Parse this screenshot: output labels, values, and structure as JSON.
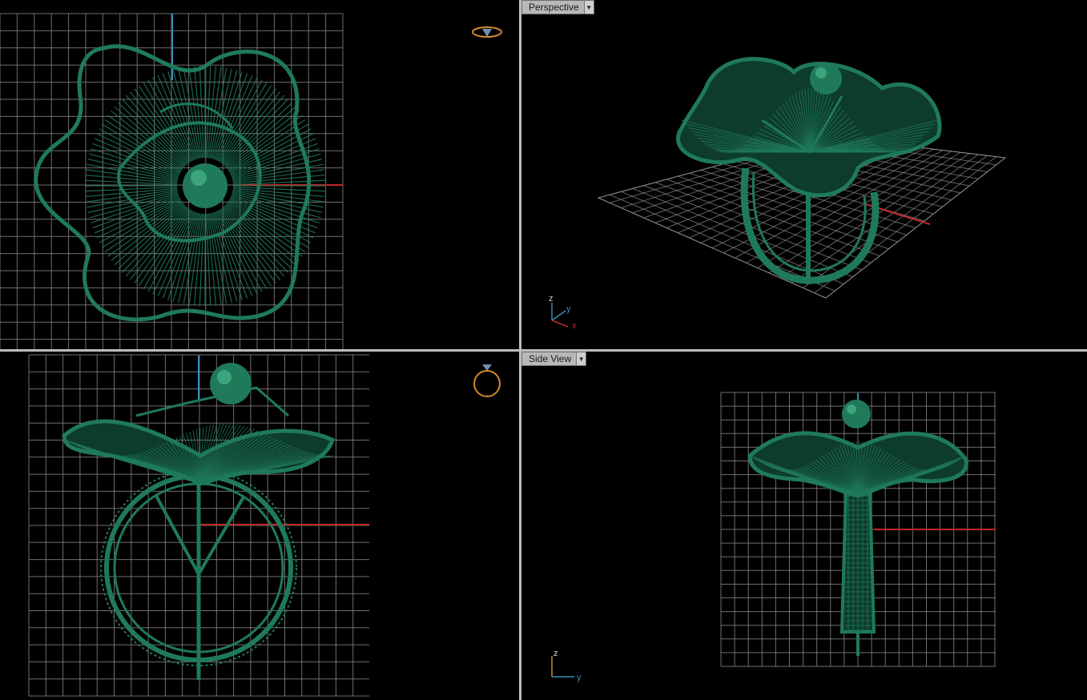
{
  "viewports": {
    "top_left": {
      "label": ""
    },
    "top_right": {
      "label": "Perspective",
      "axes": {
        "z": "z",
        "y": "y",
        "x": "x"
      }
    },
    "bottom_left": {
      "label": ""
    },
    "bottom_right": {
      "label": "Side View",
      "axes": {
        "z": "z",
        "y": "y"
      }
    }
  },
  "colors": {
    "model": "#1f7a5a",
    "model_light": "#4fbf95",
    "grid": "#8a8a8a",
    "axis_x": "#c0282a",
    "axis_y": "#3a8fb5",
    "label_bg": "#b8b8b8"
  },
  "icons": {
    "top_left_corner": "ring-top-icon",
    "bottom_left_corner": "ring-front-icon"
  }
}
